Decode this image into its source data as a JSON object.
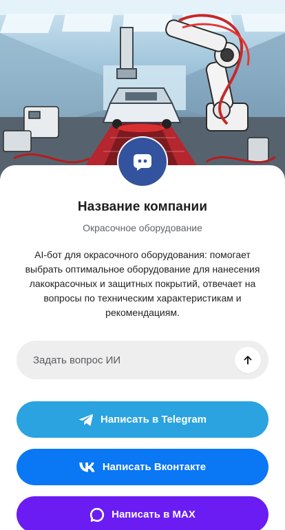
{
  "company": {
    "name": "Название компании",
    "category": "Окрасочное оборудование",
    "description": "AI-бот для окрасочного оборудования: помогает выбрать оптимальное оборудование для нанесения лакокрасочных и защитных покрытий, отвечает на вопросы по техническим характеристикам и рекомендациям."
  },
  "hero": {
    "icon": "robotic-paint-line-illustration"
  },
  "avatar": {
    "icon": "chat-bubble-icon",
    "color": "#33539e"
  },
  "ask": {
    "placeholder": "Задать вопрос ИИ",
    "send_icon": "arrow-up-icon"
  },
  "buttons": [
    {
      "label": "Написать в Telegram",
      "icon": "telegram-icon",
      "color": "#2aa3e0"
    },
    {
      "label": "Написать Вконтакте",
      "icon": "vk-icon",
      "color": "#0a77f4"
    },
    {
      "label": "Написать в MAX",
      "icon": "max-icon",
      "color": "#6a1cf2"
    }
  ]
}
